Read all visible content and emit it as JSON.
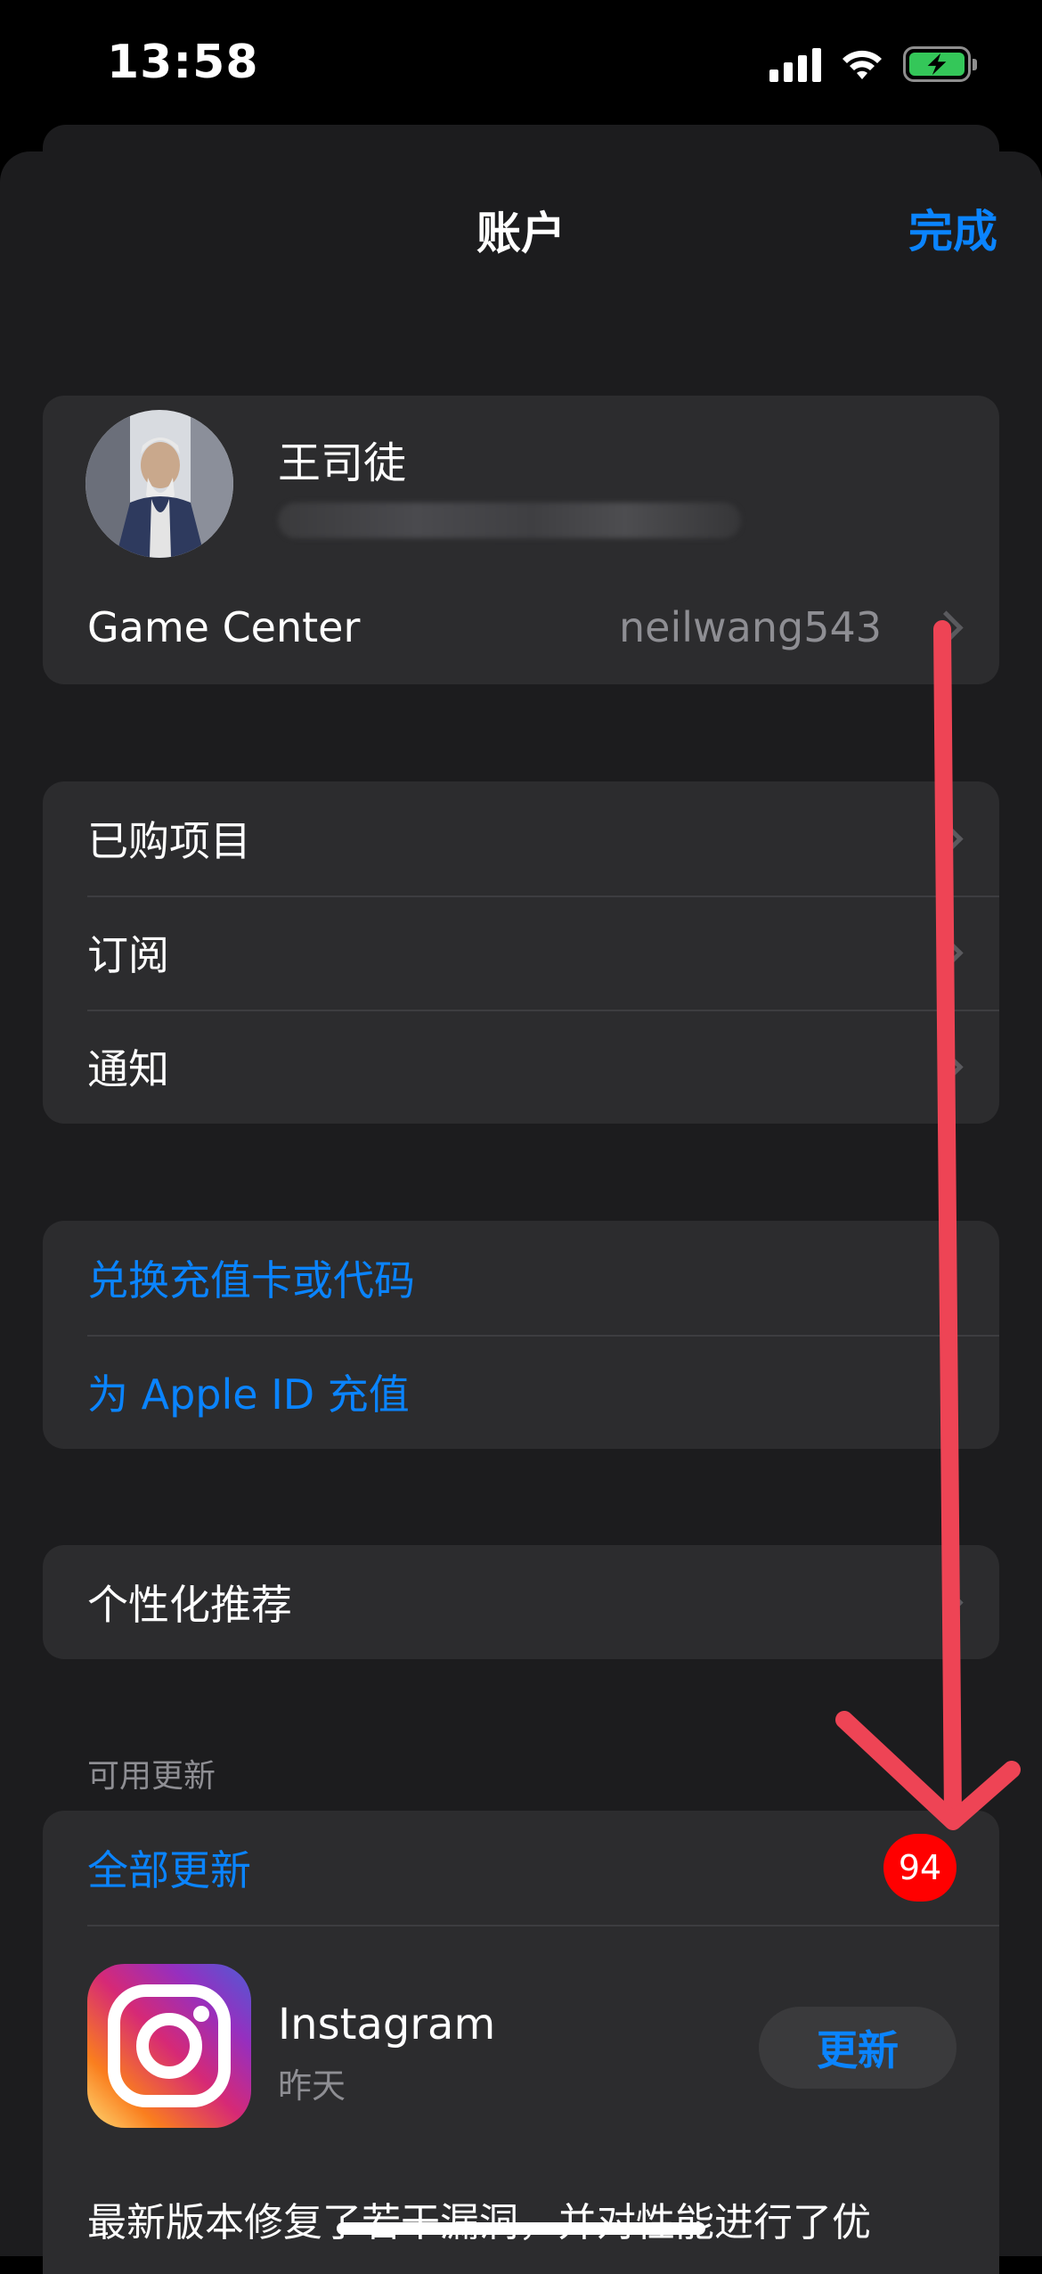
{
  "status_bar": {
    "time": "13:58"
  },
  "nav": {
    "title": "账户",
    "done_label": "完成"
  },
  "profile": {
    "name": "王司徒"
  },
  "game_center": {
    "label": "Game Center",
    "value": "neilwang543"
  },
  "menu_group": {
    "items": [
      {
        "label": "已购项目"
      },
      {
        "label": "订阅"
      },
      {
        "label": "通知"
      }
    ]
  },
  "recharge_group": {
    "items": [
      {
        "label": "兑换充值卡或代码"
      },
      {
        "label": "为 Apple ID 充值"
      }
    ]
  },
  "personalize": {
    "label": "个性化推荐"
  },
  "updates": {
    "section_header": "可用更新",
    "update_all_label": "全部更新",
    "count": "94",
    "apps": [
      {
        "name": "Instagram",
        "date": "昨天",
        "button_label": "更新",
        "description": "最新版本修复了若干漏洞，并对性能进行了优"
      }
    ]
  },
  "colors": {
    "accent": "#0a84ff",
    "badge": "#ff0000",
    "annotation_arrow": "#ee4455",
    "background": "#000000",
    "sheet": "#1c1c1e",
    "cell": "#2c2c2e"
  }
}
